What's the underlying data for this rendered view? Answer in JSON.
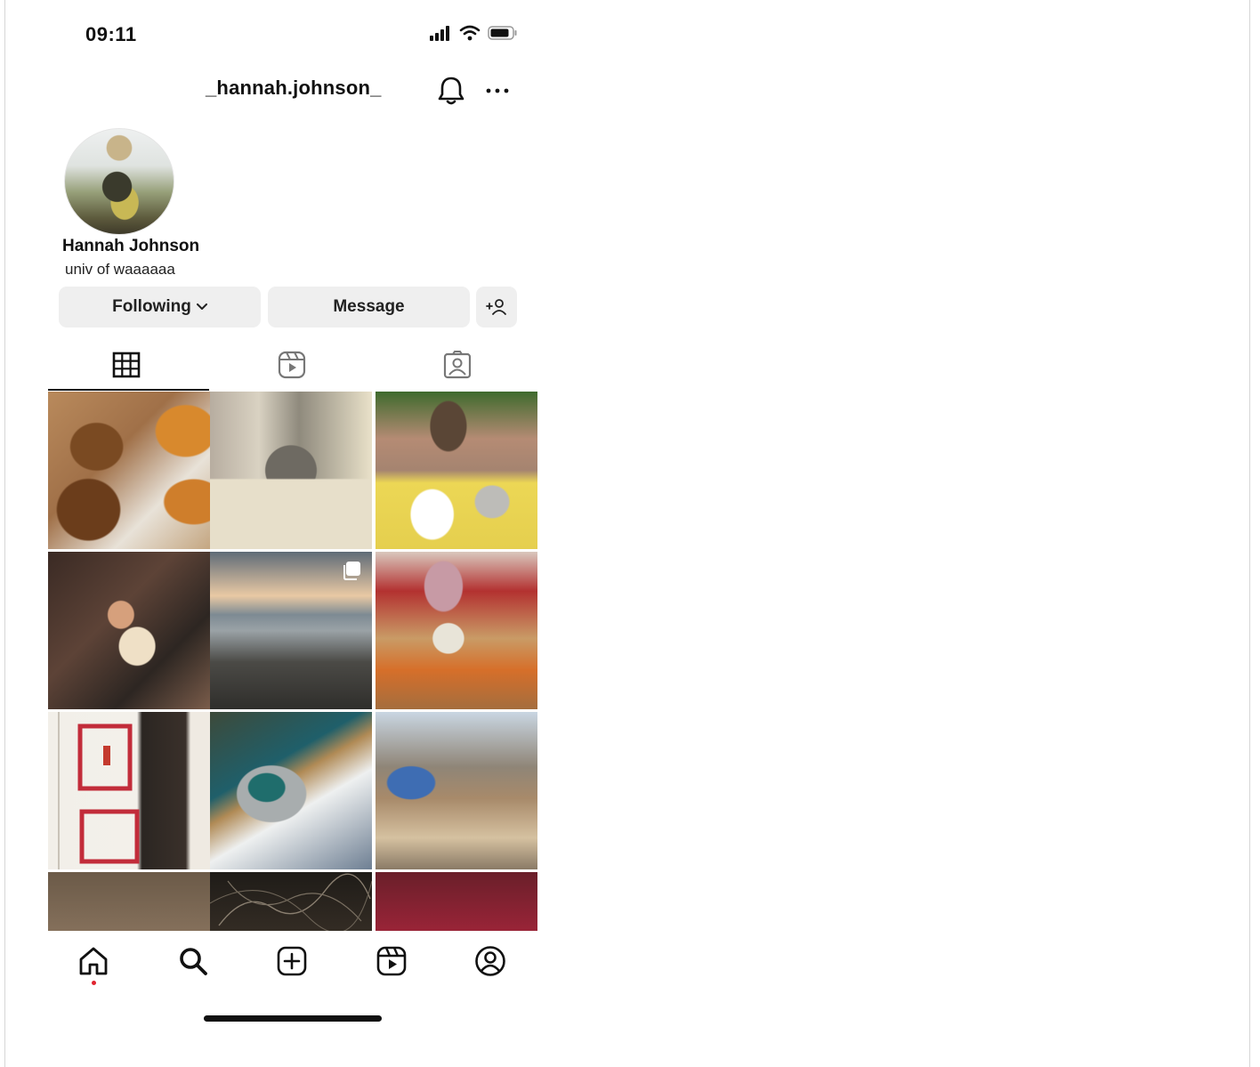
{
  "status_bar": {
    "time": "09:11"
  },
  "header": {
    "username": "_hannah.johnson_"
  },
  "profile": {
    "display_name": "Hannah Johnson",
    "bio": "univ of waaaaaa"
  },
  "actions": {
    "following_label": "Following",
    "message_label": "Message"
  },
  "tabs": [
    {
      "name": "posts",
      "icon": "grid-icon",
      "active": true
    },
    {
      "name": "reels",
      "icon": "reels-icon",
      "active": false
    },
    {
      "name": "tagged",
      "icon": "tagged-icon",
      "active": false
    }
  ],
  "posts": [
    {
      "subject": "pastries",
      "multi": false
    },
    {
      "subject": "branches-vase",
      "multi": false
    },
    {
      "subject": "vase-and-tea-tray",
      "multi": false
    },
    {
      "subject": "people-on-sofa",
      "multi": false
    },
    {
      "subject": "rocky-coast-sunset",
      "multi": true
    },
    {
      "subject": "flowers-pitcher",
      "multi": false
    },
    {
      "subject": "white-door",
      "multi": false
    },
    {
      "subject": "tea-tray-cushions",
      "multi": false
    },
    {
      "subject": "person-by-woodpile",
      "multi": false
    },
    {
      "subject": "cave",
      "multi": false
    },
    {
      "subject": "night-branches",
      "multi": false
    },
    {
      "subject": "tea-table",
      "multi": false
    }
  ],
  "bottom_nav": [
    "home-icon",
    "search-icon",
    "create-icon",
    "reels-icon",
    "profile-icon"
  ],
  "colors": {
    "notification_dot": "#e0242f",
    "button_bg": "#efefef"
  }
}
